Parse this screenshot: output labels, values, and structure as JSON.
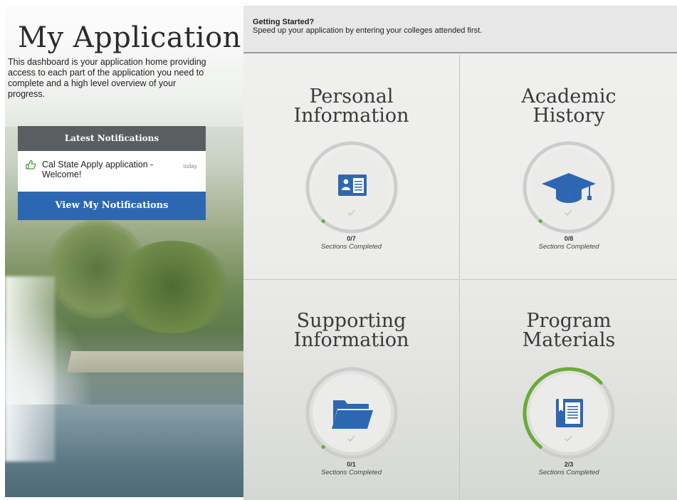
{
  "page": {
    "title": "My Application",
    "intro": "This dashboard is your application home providing access to each part of the application you need to complete and a high level overview of your progress."
  },
  "notifications": {
    "header": "Latest Notifications",
    "items": [
      {
        "text": "Cal State Apply application - Welcome!",
        "time": "today",
        "icon": "thumbs-up-icon"
      }
    ],
    "button": "View My Notifications"
  },
  "banner": {
    "title": "Getting Started?",
    "text": "Speed up your application by entering your colleges attended first."
  },
  "colors": {
    "brand_blue": "#2e67b1",
    "progress_green": "#6aab3a",
    "ring_gray": "#c8c8c8",
    "notif_header": "#5b5e60"
  },
  "tiles": [
    {
      "title_line1": "Personal",
      "title_line2": "Information",
      "progress": "0/7",
      "completed": 0,
      "total": 7,
      "caption": "Sections Completed",
      "icon": "id-card-icon"
    },
    {
      "title_line1": "Academic",
      "title_line2": "History",
      "progress": "0/8",
      "completed": 0,
      "total": 8,
      "caption": "Sections Completed",
      "icon": "graduation-cap-icon"
    },
    {
      "title_line1": "Supporting",
      "title_line2": "Information",
      "progress": "0/1",
      "completed": 0,
      "total": 1,
      "caption": "Sections Completed",
      "icon": "folder-icon"
    },
    {
      "title_line1": "Program",
      "title_line2": "Materials",
      "progress": "2/3",
      "completed": 2,
      "total": 3,
      "caption": "Sections Completed",
      "icon": "book-icon"
    }
  ]
}
